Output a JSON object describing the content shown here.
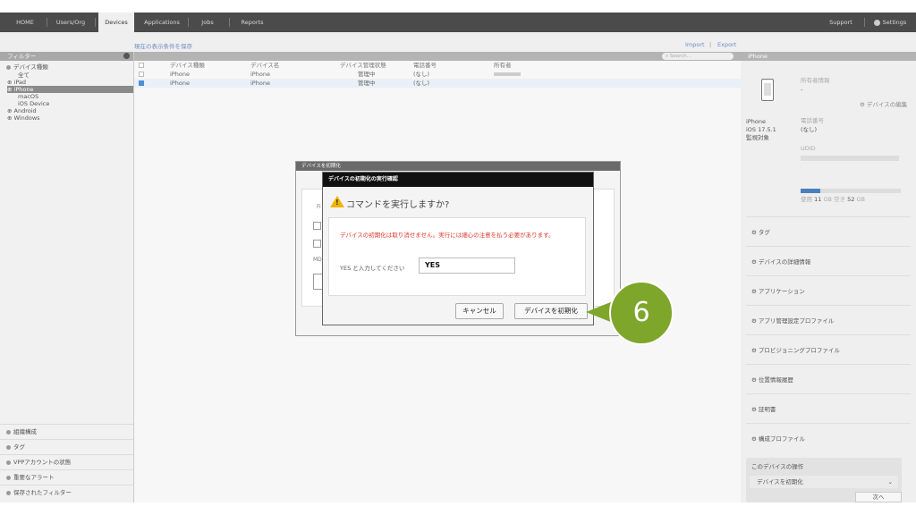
{
  "nav": {
    "items": [
      "HOME",
      "Users/Org",
      "Devices",
      "Applications",
      "Jobs",
      "Reports"
    ],
    "support": "Support",
    "settings": "Settings"
  },
  "subheader": {
    "save_filter": "現在の表示条件を保存",
    "import": "Import",
    "sep": "|",
    "export": "Export"
  },
  "sidebar": {
    "filter_title": "フィルター",
    "device_type_title": "デバイス種類",
    "tree": [
      {
        "label": "全て",
        "indent": true,
        "selected": false
      },
      {
        "label": "iPad",
        "indent": false,
        "selected": false
      },
      {
        "label": "iPhone",
        "indent": false,
        "selected": true
      },
      {
        "label": "macOS",
        "indent": true,
        "selected": false
      },
      {
        "label": "iOS Device",
        "indent": true,
        "selected": false
      },
      {
        "label": "Android",
        "indent": false,
        "selected": false
      },
      {
        "label": "Windows",
        "indent": false,
        "selected": false
      }
    ],
    "bottom": [
      "組織構成",
      "タグ",
      "VPPアカウントの状態",
      "重要なアラート",
      "保存されたフィルター"
    ]
  },
  "table": {
    "search_placeholder": "Search...",
    "headers": [
      "デバイス種類",
      "デバイス名",
      "デバイス管理状態",
      "電話番号",
      "所有者"
    ],
    "rows": [
      {
        "type": "iPhone",
        "name": "iPhone",
        "status": "管理中",
        "phone": "(なし)",
        "checked": false
      },
      {
        "type": "iPhone",
        "name": "iPhone",
        "status": "管理中",
        "phone": "(なし)",
        "checked": true
      }
    ]
  },
  "right": {
    "title": "iPhone",
    "owner_label": "所有者情報",
    "owner_value": "-",
    "edit_link": "デバイスの編集",
    "model": "iPhone",
    "os": "iOS 17.5.1",
    "supervised": "監視対象",
    "phone_label": "電話番号",
    "phone_value": "(なし)",
    "udid_label": "UDID",
    "storage_used_label": "使用",
    "storage_used": "11",
    "storage_free_label": "空き",
    "storage_free": "52",
    "storage_unit": "GB",
    "storage_used_fraction": 0.2,
    "sections": [
      "タグ",
      "デバイスの詳細情報",
      "アプリケーション",
      "アプリ管理設定プロファイル",
      "プロビジョニングプロファイル",
      "位置情報履歴",
      "証明書",
      "構成プロファイル"
    ],
    "ops_title": "このデバイスの操作",
    "ops_select": "デバイスを初期化",
    "next": "次へ"
  },
  "outer_dialog": {
    "title": "デバイスを初期化",
    "fragment_f": "Fi",
    "fragment_md": "MD"
  },
  "dialog": {
    "title": "デバイスの初期化の実行確認",
    "question": "コマンドを実行しますか?",
    "warning": "デバイスの初期化は取り消せません。実行には細心の注意を払う必要があります。",
    "input_label": "YES と入力してください",
    "input_value": "YES",
    "cancel": "キャンセル",
    "confirm": "デバイスを初期化"
  },
  "step_badge": "6"
}
